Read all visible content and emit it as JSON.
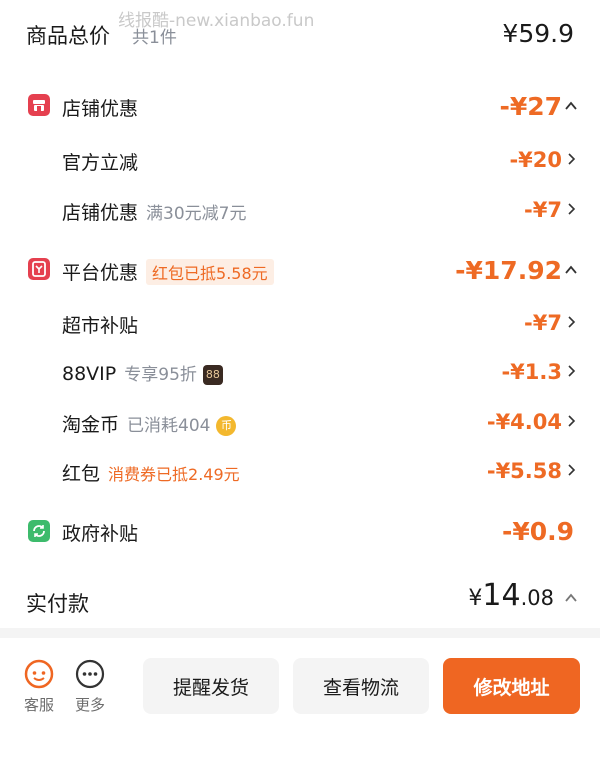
{
  "watermark": "线报酷-new.xianbao.fun",
  "header": {
    "title": "商品总价",
    "count": "共1件",
    "price": "¥59.9"
  },
  "store": {
    "label": "店铺优惠",
    "amount": "-¥27",
    "items": [
      {
        "label": "官方立减",
        "sub": "",
        "amount": "-¥20"
      },
      {
        "label": "店铺优惠",
        "sub": "满30元减7元",
        "amount": "-¥7"
      }
    ]
  },
  "platform": {
    "label": "平台优惠",
    "tag": "红包已抵5.58元",
    "amount": "-¥17.92",
    "items": [
      {
        "label": "超市补贴",
        "amount": "-¥7"
      },
      {
        "label": "88VIP",
        "sub": "专享95折",
        "badge": "88",
        "amount": "-¥1.3"
      },
      {
        "label": "淘金币",
        "sub": "已消耗404",
        "badge": "币",
        "amount": "-¥4.04"
      },
      {
        "label": "红包",
        "sub": "消费券已抵2.49元",
        "amount": "-¥5.58"
      }
    ]
  },
  "gov": {
    "label": "政府补贴",
    "amount": "-¥0.9"
  },
  "total": {
    "label": "实付款",
    "currency": "¥",
    "integer": "14",
    "decimal": ".08"
  },
  "footer": {
    "service": "客服",
    "more": "更多",
    "remind": "提醒发货",
    "logistics": "查看物流",
    "address": "修改地址"
  },
  "colors": {
    "accent": "#ef6622",
    "store_icon": "#e5404f",
    "gov_icon": "#3dbb6c"
  }
}
